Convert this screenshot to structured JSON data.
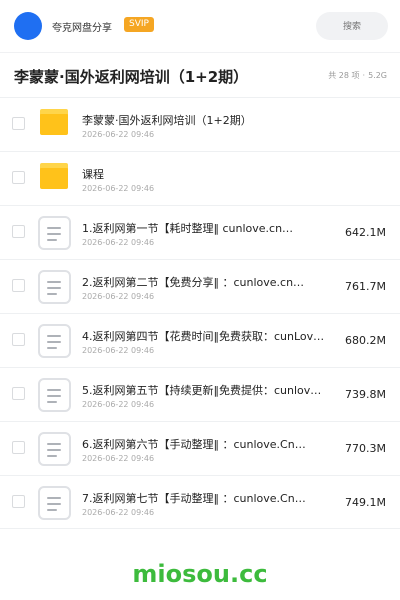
{
  "header": {
    "app_name": "夸克网盘分享",
    "badge": "SVIP",
    "search_placeholder": "搜索"
  },
  "folder": {
    "title": "李蒙蒙·国外返利网培训（1+2期）",
    "count": "共 28 项",
    "separator": "·",
    "size": "5.2G"
  },
  "items": [
    {
      "type": "folder",
      "name": "李蒙蒙·国外返利网培训（1+2期）",
      "date": "2026-06-22 09:46",
      "size": ""
    },
    {
      "type": "folder",
      "name": "课程",
      "date": "2026-06-22 09:46",
      "size": ""
    },
    {
      "type": "file",
      "name": "1.返利网第一节【耗时整理‖ cunlove.cn…",
      "date": "2026-06-22 09:46",
      "size": "642.1M"
    },
    {
      "type": "file",
      "name": "2.返利网第二节【免费分享‖ ：cunlove.cn…",
      "date": "2026-06-22 09:46",
      "size": "761.7M"
    },
    {
      "type": "file",
      "name": "4.返利网第四节【花费时间‖免费获取：cunLov…",
      "date": "2026-06-22 09:46",
      "size": "680.2M"
    },
    {
      "type": "file",
      "name": "5.返利网第五节【持续更新‖免费提供：cunlov…",
      "date": "2026-06-22 09:46",
      "size": "739.8M"
    },
    {
      "type": "file",
      "name": "6.返利网第六节【手动整理‖ ：cunlove.Cn…",
      "date": "2026-06-22 09:46",
      "size": "770.3M"
    },
    {
      "type": "file",
      "name": "7.返利网第七节【手动整理‖ ：cunlove.Cn…",
      "date": "2026-06-22 09:46",
      "size": "749.1M"
    }
  ],
  "watermark": "miosou.cc",
  "colors": {
    "accent": "#1f6ff2",
    "badge": "#f5a623",
    "folder": "#ffc21a",
    "watermark": "#3dbb3d"
  }
}
